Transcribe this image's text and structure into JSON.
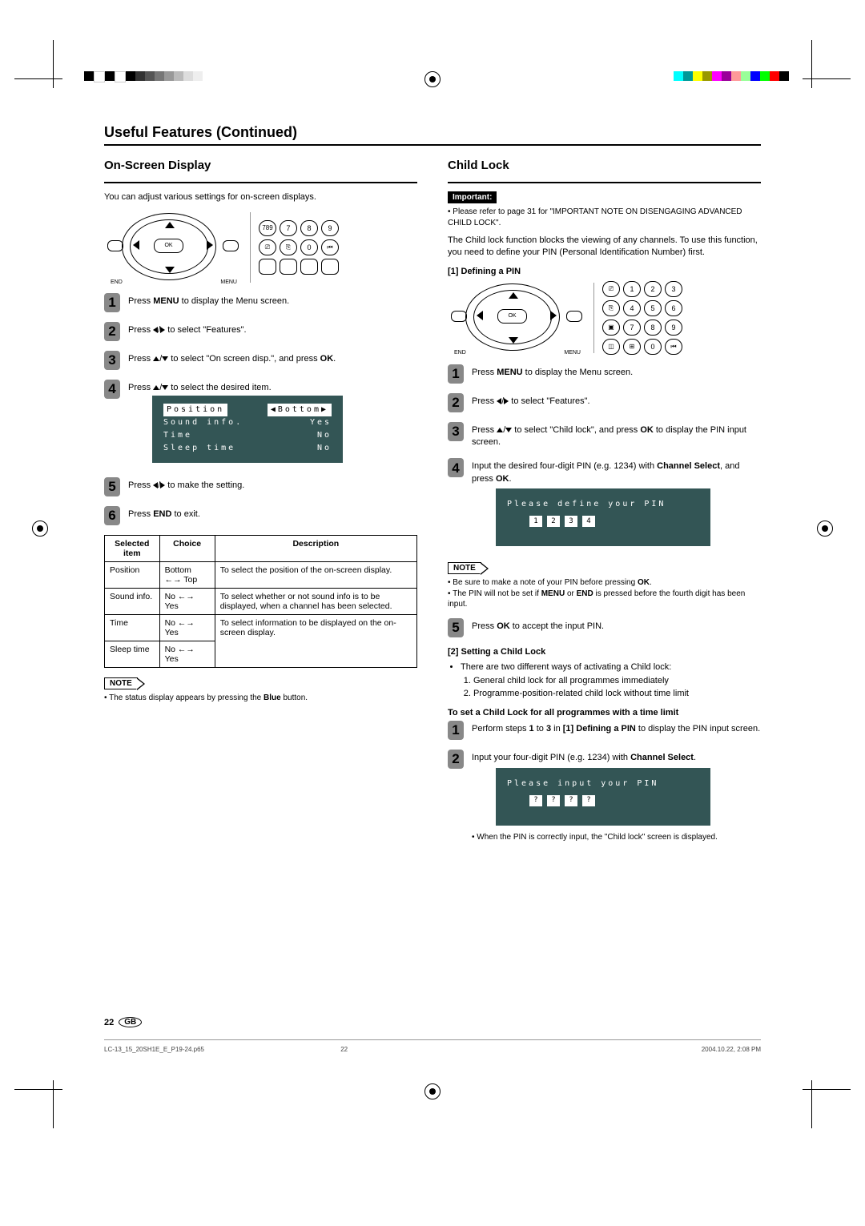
{
  "page_title": "Useful Features (Continued)",
  "left": {
    "heading": "On-Screen Display",
    "intro": "You can adjust various settings for on-screen displays.",
    "remote": {
      "ok": "OK",
      "end": "END",
      "menu": "MENU"
    },
    "right_cluster_row1": [
      "789",
      "7",
      "8",
      "9"
    ],
    "right_cluster_row2": [
      "⎚",
      "⎘",
      "0",
      "⏮"
    ],
    "steps": {
      "s1a": "Press ",
      "s1b": "MENU",
      "s1c": " to display the Menu screen.",
      "s2a": "Press ",
      "s2b": " to select \"Features\".",
      "s3a": "Press ",
      "s3b": " to select \"On screen disp.\", and press ",
      "s3c": "OK",
      "s3d": ".",
      "s4a": "Press ",
      "s4b": " to select the desired item.",
      "s5a": "Press ",
      "s5b": " to make the setting.",
      "s6a": "Press ",
      "s6b": "END",
      "s6c": " to exit."
    },
    "osd": {
      "row1a": "Position",
      "row1b": "◀Bottom▶",
      "row2a": "Sound info.",
      "row2b": "Yes",
      "row3a": "Time",
      "row3b": "No",
      "row4a": "Sleep time",
      "row4b": "No"
    },
    "table": {
      "h1": "Selected item",
      "h2": "Choice",
      "h3": "Description",
      "r1c1": "Position",
      "r1c2": "Bottom ←→ Top",
      "r1c3": "To select the position of the on-screen display.",
      "r2c1": "Sound info.",
      "r2c2": "No ←→ Yes",
      "r2c3": "To select whether or not sound info is to be displayed, when a channel has been selected.",
      "r3c1": "Time",
      "r3c2": "No ←→ Yes",
      "r3c3": "To select information to be displayed on the on-screen display.",
      "r4c1": "Sleep time",
      "r4c2": "No ←→ Yes"
    },
    "note_label": "NOTE",
    "note1": "The status display appears by pressing the ",
    "note1b": "Blue",
    "note1c": " button."
  },
  "right": {
    "heading": "Child Lock",
    "important_label": "Important:",
    "important_text": "Please refer to page 31 for \"IMPORTANT NOTE ON DISENGAGING ADVANCED CHILD LOCK\".",
    "intro": "The Child lock function blocks the viewing of any channels. To use this function, you need to define your PIN (Personal Identification Number) first.",
    "sub1": "[1] Defining a PIN",
    "remote": {
      "ok": "OK",
      "end": "END",
      "menu": "MENU"
    },
    "grid": {
      "r1": [
        "⎚",
        "1",
        "2",
        "3"
      ],
      "r2": [
        "⎘",
        "4",
        "5",
        "6"
      ],
      "r3": [
        "▣",
        "7",
        "8",
        "9"
      ],
      "r4": [
        "◫",
        "⊞",
        "0",
        "⏮"
      ]
    },
    "steps": {
      "s1a": "Press ",
      "s1b": "MENU",
      "s1c": " to display the Menu screen.",
      "s2a": "Press ",
      "s2b": " to select \"Features\".",
      "s3a": "Press ",
      "s3b": " to select \"Child lock\", and press ",
      "s3c": "OK",
      "s3d": " to display the PIN input screen.",
      "s4a": "Input the desired four-digit PIN (e.g. 1234) with ",
      "s4b": "Channel Select",
      "s4c": ", and press ",
      "s4d": "OK",
      "s4e": ".",
      "s5a": "Press ",
      "s5b": "OK",
      "s5c": " to accept the input PIN."
    },
    "pin_define": {
      "title": "Please define your PIN",
      "cells": [
        "1",
        "2",
        "3",
        "4"
      ]
    },
    "note_label": "NOTE",
    "note_items": {
      "n1a": "Be sure to make a note of your PIN before pressing ",
      "n1b": "OK",
      "n1c": ".",
      "n2a": "The PIN will not be set if ",
      "n2b": "MENU",
      "n2c": " or ",
      "n2d": "END",
      "n2e": " is pressed before the fourth digit has been input."
    },
    "sub2": "[2] Setting a Child Lock",
    "sub2_intro": "There are two different ways of activating a Child lock:",
    "sub2_list": {
      "l1": "General child lock for all programmes immediately",
      "l2": "Programme-position-related child lock without time limit"
    },
    "sub3": "To set a Child Lock for all programmes with a time limit",
    "steps2": {
      "s1a": "Perform steps ",
      "s1b": "1",
      "s1c": " to ",
      "s1d": "3",
      "s1e": " in ",
      "s1f": "[1] Defining a PIN",
      "s1g": " to display the PIN input screen.",
      "s2a": "Input your four-digit PIN (e.g. 1234) with ",
      "s2b": "Channel Select",
      "s2c": "."
    },
    "pin_input": {
      "title": "Please input your PIN",
      "cells": [
        "?",
        "?",
        "?",
        "?"
      ]
    },
    "after_pin": "When the PIN is correctly input, the \"Child lock\" screen is displayed."
  },
  "footer": {
    "page_num": "22",
    "gb": "GB",
    "file": "LC-13_15_20SH1E_E_P19-24.p65",
    "mid": "22",
    "date": "2004.10.22, 2:08 PM"
  }
}
